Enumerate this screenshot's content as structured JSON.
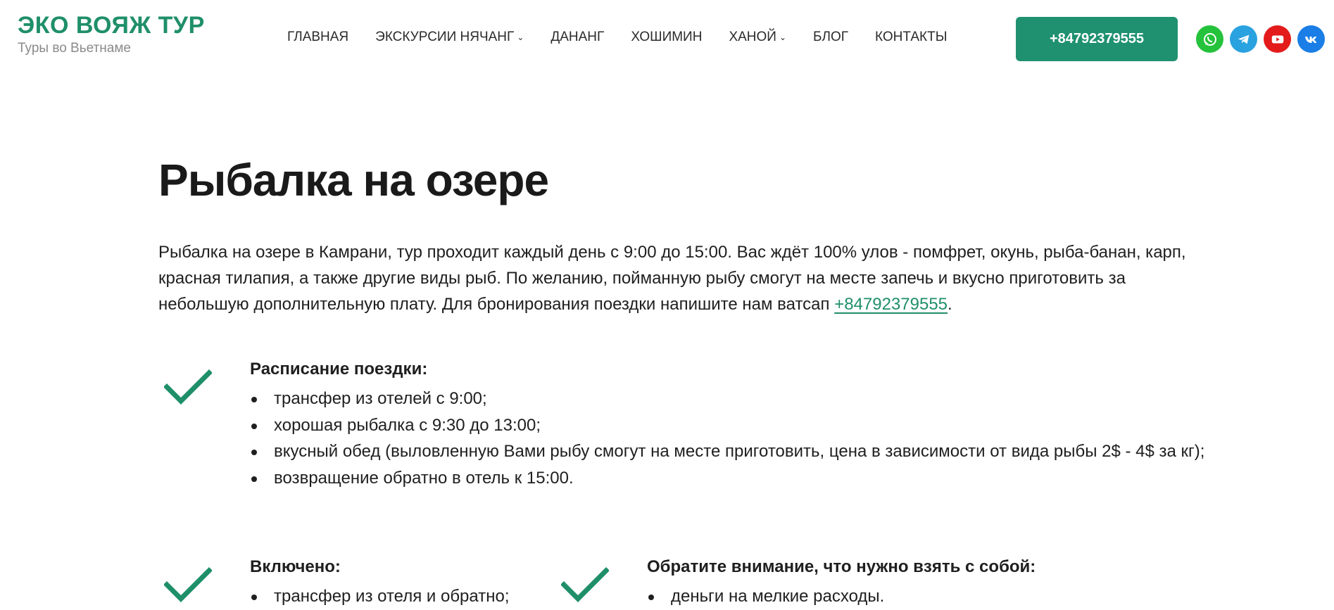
{
  "header": {
    "logo_title": "ЭКО ВОЯЖ ТУР",
    "logo_subtitle": "Туры во Вьетнаме",
    "nav": [
      {
        "label": "ГЛАВНАЯ",
        "has_dropdown": false
      },
      {
        "label": "ЭКСКУРСИИ НЯЧАНГ",
        "has_dropdown": true
      },
      {
        "label": "ДАНАНГ",
        "has_dropdown": false
      },
      {
        "label": "ХОШИМИН",
        "has_dropdown": false
      },
      {
        "label": "ХАНОЙ",
        "has_dropdown": true
      },
      {
        "label": "БЛОГ",
        "has_dropdown": false
      },
      {
        "label": "КОНТАКТЫ",
        "has_dropdown": false
      }
    ],
    "phone_button": "+84792379555",
    "social": [
      {
        "icon": "whatsapp-icon",
        "color": "#25c23c"
      },
      {
        "icon": "telegram-icon",
        "color": "#2aa2e0"
      },
      {
        "icon": "youtube-icon",
        "color": "#e31b1b"
      },
      {
        "icon": "vk-icon",
        "color": "#1a7ee6"
      }
    ]
  },
  "main": {
    "title": "Рыбалка на озере",
    "intro": "Рыбалка на озере в Камрани, тур проходит каждый день с 9:00 до 15:00. Вас ждёт 100% улов - помфрет, окунь, рыба-банан, карп, красная тилапия, а также другие виды рыб. По желанию, пойманную рыбу смогут на месте запечь и вкусно приготовить за небольшую дополнительную плату. Для бронирования поездки напишите нам ватсап ",
    "intro_link": "+84792379555",
    "intro_end": ".",
    "schedule": {
      "title": "Расписание поездки:",
      "items": [
        "трансфер из отелей с 9:00;",
        "хорошая рыбалка с 9:30 до 13:00;",
        "вкусный обед (выловленную Вами рыбу смогут на месте приготовить, цена в зависимости от вида рыбы 2$ - 4$ за кг);",
        "возвращение обратно в отель к 15:00."
      ]
    },
    "included": {
      "title": "Включено:",
      "items": [
        "трансфер из отеля и обратно;"
      ]
    },
    "bring": {
      "title": "Обратите внимание, что нужно взять с собой:",
      "items": [
        "деньги на мелкие расходы."
      ]
    }
  },
  "colors": {
    "accent": "#1f9170",
    "text": "#1f1f1f"
  }
}
